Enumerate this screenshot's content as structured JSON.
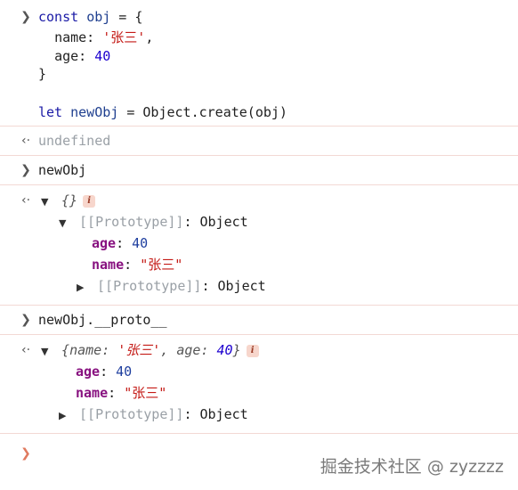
{
  "console": {
    "input1": {
      "l1_kw": "const",
      "l1_name": "obj",
      "l1_rest": " = {",
      "l2_key": "name:",
      "l2_val": "'张三'",
      "l2_end": ",",
      "l3_key": "age:",
      "l3_val": "40",
      "l4": "}",
      "l6_kw": "let",
      "l6_name": "newObj",
      "l6_rest": " = Object.create(obj)"
    },
    "result1": "undefined",
    "input2": "newObj",
    "output2": {
      "summary": "{}",
      "proto_label": "[[Prototype]]",
      "proto_type": ": Object",
      "age_key": "age",
      "age_val": "40",
      "name_key": "name",
      "name_val": "\"张三\"",
      "inner_proto_label": "[[Prototype]]",
      "inner_proto_type": ": Object"
    },
    "input3": "newObj.__proto__",
    "output3": {
      "summary_open": "{",
      "name_key": "name",
      "name_val": "'张三'",
      "sep": ", ",
      "age_key": "age",
      "age_val": "40",
      "summary_close": "}",
      "age_key2": "age",
      "age_val2": "40",
      "name_key2": "name",
      "name_val2": "\"张三\"",
      "proto_label": "[[Prototype]]",
      "proto_type": ": Object"
    },
    "info_glyph": "i"
  },
  "watermark": "掘金技术社区 @ zyzzzz",
  "icons": {
    "input_prompt": "chevron-right-icon",
    "result_prompt": "return-arrow-icon",
    "expand_open": "triangle-down-icon",
    "expand_closed": "triangle-right-icon"
  }
}
